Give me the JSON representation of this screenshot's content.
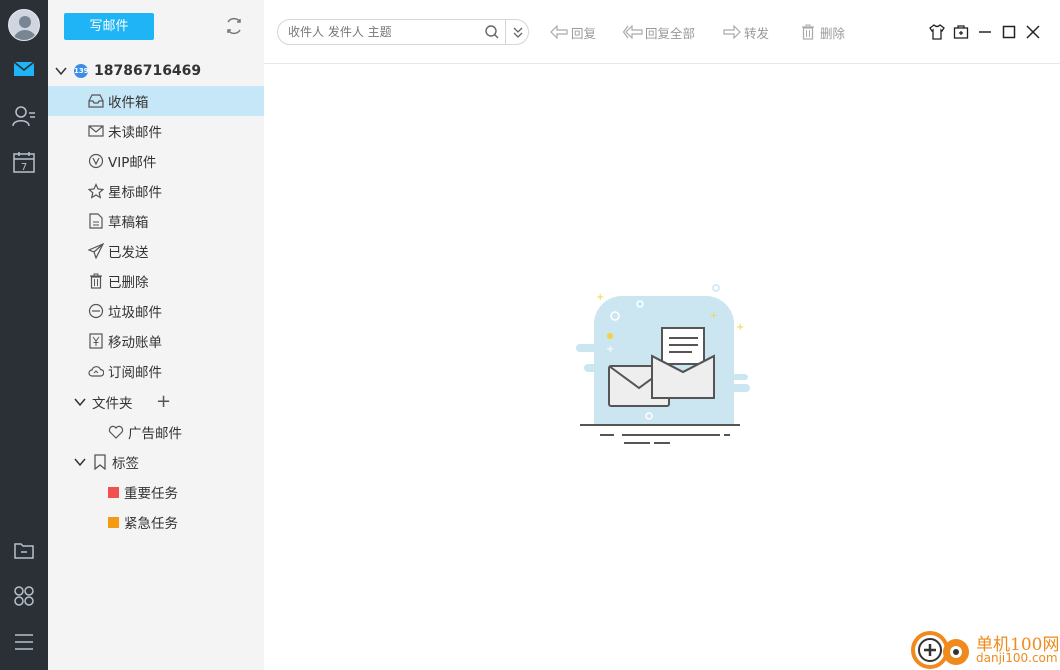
{
  "toolbar": {
    "compose_label": "写邮件",
    "search_placeholder": "收件人 发件人 主题",
    "reply_label": "回复",
    "reply_all_label": "回复全部",
    "forward_label": "转发",
    "delete_label": "删除"
  },
  "account": {
    "badge": "139",
    "number": "18786716469"
  },
  "folders": [
    {
      "label": "收件箱",
      "icon": "inbox-icon",
      "active": true
    },
    {
      "label": "未读邮件",
      "icon": "envelope-icon"
    },
    {
      "label": "VIP邮件",
      "icon": "vip-icon"
    },
    {
      "label": "星标邮件",
      "icon": "star-icon"
    },
    {
      "label": "草稿箱",
      "icon": "draft-icon"
    },
    {
      "label": "已发送",
      "icon": "paper-plane-icon"
    },
    {
      "label": "已删除",
      "icon": "trash-icon"
    },
    {
      "label": "垃圾邮件",
      "icon": "block-icon"
    },
    {
      "label": "移动账单",
      "icon": "yen-icon"
    },
    {
      "label": "订阅邮件",
      "icon": "cloud-icon"
    }
  ],
  "custom_folders": {
    "label": "文件夹",
    "items": [
      {
        "label": "广告邮件",
        "icon": "tag-heart-icon"
      }
    ]
  },
  "tags": {
    "label": "标签",
    "items": [
      {
        "label": "重要任务",
        "color": "#f0504e"
      },
      {
        "label": "紧急任务",
        "color": "#f49a14"
      }
    ]
  },
  "rail_icons": [
    "avatar",
    "mail-icon",
    "contacts-icon",
    "calendar-icon",
    "file-folder-icon",
    "apps-icon",
    "menu-icon"
  ],
  "calendar_day": "7",
  "watermark": {
    "line1": "单机100网",
    "line2": "danji100.com"
  },
  "colors": {
    "rail_bg": "#2b2f36",
    "accent": "#1fb4f5",
    "active_row": "#c6e7f7"
  }
}
